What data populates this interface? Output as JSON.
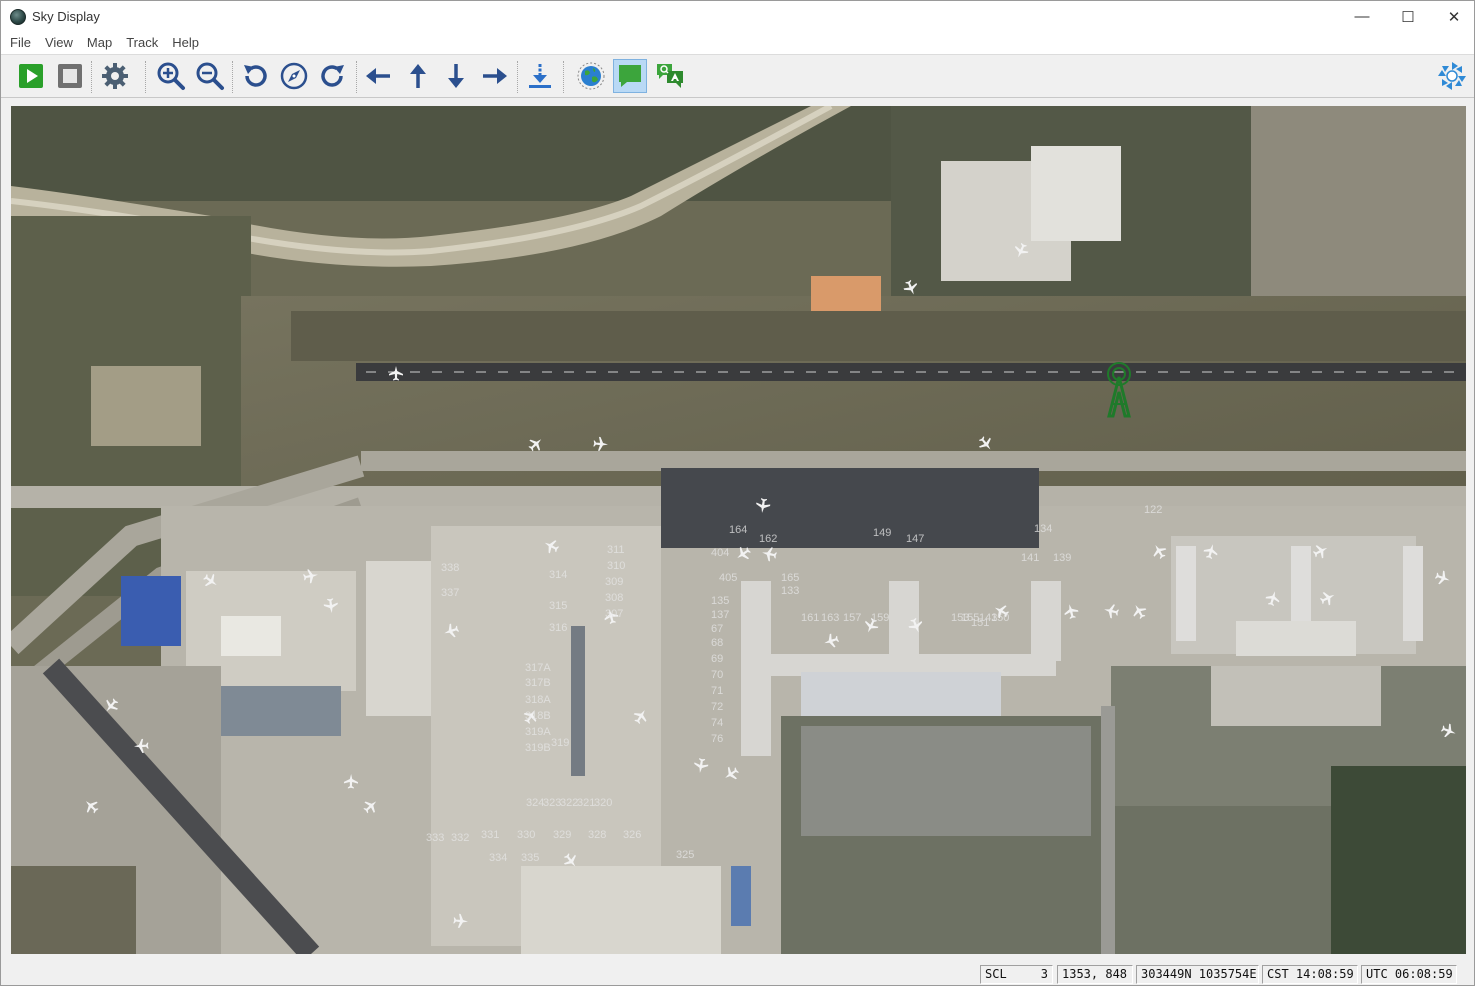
{
  "window": {
    "title": "Sky Display"
  },
  "controls": {
    "minimize": "—",
    "maximize": "☐",
    "close": "✕"
  },
  "menu": [
    "File",
    "View",
    "Map",
    "Track",
    "Help"
  ],
  "toolbar": {
    "buttons": [
      {
        "name": "play-button",
        "icon": "play-icon",
        "color": "#2aa02a"
      },
      {
        "name": "stop-button",
        "icon": "stop-icon",
        "color": "#6a6a6a"
      },
      {
        "name": "settings-button",
        "icon": "gear-icon",
        "color": "#4b5f73"
      },
      {
        "name": "zoom-in-button",
        "icon": "zoom-in-icon",
        "color": "#2b4f8e"
      },
      {
        "name": "zoom-out-button",
        "icon": "zoom-out-icon",
        "color": "#2b4f8e"
      },
      {
        "name": "rotate-left-button",
        "icon": "rotate-left-icon",
        "color": "#2b4f8e"
      },
      {
        "name": "compass-button",
        "icon": "compass-icon",
        "color": "#2b4f8e"
      },
      {
        "name": "rotate-right-button",
        "icon": "rotate-right-icon",
        "color": "#2b4f8e"
      },
      {
        "name": "pan-left-button",
        "icon": "arrow-left-icon",
        "color": "#2b4f8e"
      },
      {
        "name": "pan-up-button",
        "icon": "arrow-up-icon",
        "color": "#2b4f8e"
      },
      {
        "name": "pan-down-button",
        "icon": "arrow-down-icon",
        "color": "#2b4f8e"
      },
      {
        "name": "pan-right-button",
        "icon": "arrow-right-icon",
        "color": "#2b4f8e"
      },
      {
        "name": "download-button",
        "icon": "download-icon",
        "color": "#2b6fc8"
      },
      {
        "name": "globe-button",
        "icon": "globe-icon",
        "color": "#2a7fd0"
      },
      {
        "name": "message-button",
        "icon": "chat-bubble-icon",
        "color": "#3ca53c"
      },
      {
        "name": "qa-button",
        "icon": "qa-chat-icon",
        "color": "#3ca53c"
      }
    ],
    "logo": "app-logo-icon"
  },
  "map": {
    "stand_labels": [
      "164",
      "162",
      "149",
      "147",
      "134",
      "122",
      "311",
      "310",
      "309",
      "308",
      "307",
      "314",
      "315",
      "316",
      "317A",
      "317B",
      "318A",
      "318B",
      "319A",
      "319B",
      "319",
      "320",
      "321",
      "322",
      "323",
      "324",
      "325",
      "326",
      "328",
      "329",
      "330",
      "331",
      "332",
      "333",
      "334",
      "335",
      "337",
      "338",
      "404",
      "405",
      "165",
      "163",
      "159",
      "155",
      "151",
      "150",
      "141",
      "139",
      "135",
      "133",
      "161",
      "157",
      "153",
      "143",
      "137",
      "67",
      "68",
      "69",
      "70",
      "71",
      "72",
      "74",
      "76"
    ],
    "radar_color": "#1f7a2a"
  },
  "status": {
    "scale_label": "SCL",
    "scale_value": "3",
    "cursor": "1353, 848",
    "coords": "303449N 1035754E",
    "cst": "CST 14:08:59",
    "utc": "UTC 06:08:59"
  }
}
